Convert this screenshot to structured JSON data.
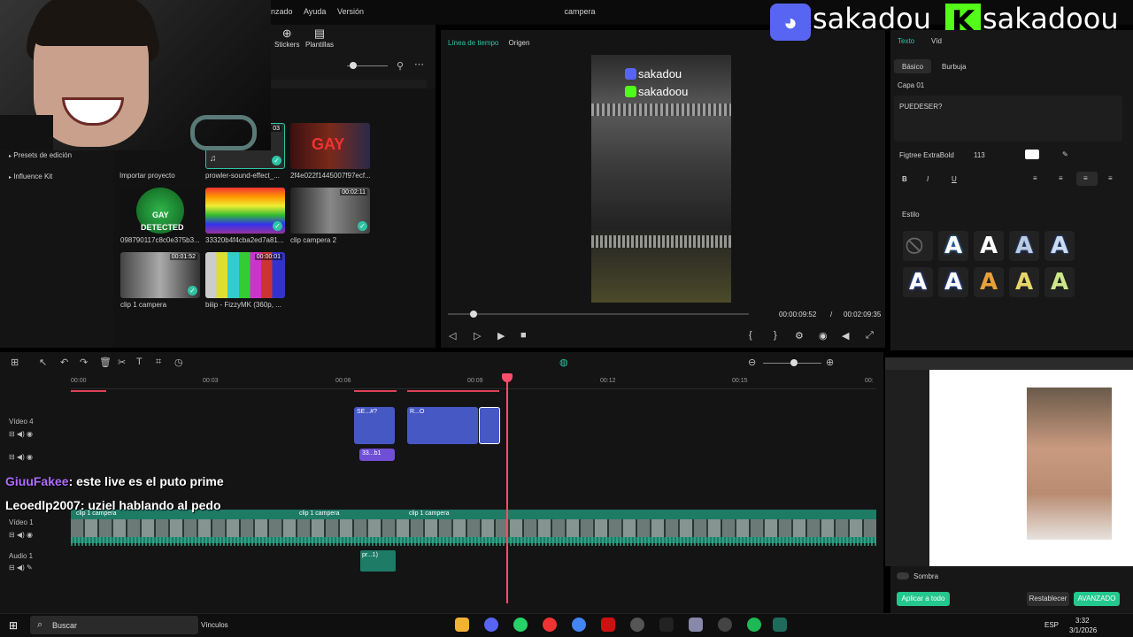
{
  "menubar": {
    "items": [
      "nzado",
      "Ayuda",
      "Versión"
    ],
    "title": "campera"
  },
  "left_panel": {
    "tools": [
      "Stickers",
      "Plantillas"
    ],
    "side_items": [
      "Presets de edición",
      "Influence Kit"
    ],
    "import_label": "Importar proyecto",
    "thumbs": [
      {
        "label": "prowler-sound-effect_...",
        "time": "03"
      },
      {
        "label": "2f4e022f1445007f97ecf...",
        "art": "GAY"
      },
      {
        "label": "098790117c8c0e375b3...",
        "art_line1": "GAY",
        "art_line2": "DETECTED"
      },
      {
        "label": "33320b4f4cba2ed7a81..."
      },
      {
        "label": "clip campera 2",
        "time": "00:02:11"
      },
      {
        "label": "clip 1 campera",
        "time": "00:01:52"
      },
      {
        "label": "biiip - FizzyMK (360p, ...",
        "time": "00:00:01"
      }
    ]
  },
  "preview": {
    "tabs": [
      "Línea de tiempo",
      "Origen"
    ],
    "overlay_discord": "sakadou",
    "overlay_kick": "sakadoou",
    "current_time": "00:00:09:52",
    "separator": "/",
    "total_time": "00:02:09:35"
  },
  "branding": {
    "discord_name": "sakadou",
    "kick_name": "sakadoou",
    "discord_color": "#5865f2",
    "kick_color": "#53fc18"
  },
  "right_panel": {
    "tabs": [
      "Texto",
      "Víd"
    ],
    "subtabs": [
      "Básico",
      "Burbuja"
    ],
    "layer": "Capa 01",
    "text_value": "PUEDESER?",
    "font": "Figtree ExtraBold",
    "size": "113",
    "style_label": "Estilo",
    "shadow_label": "Sombra",
    "apply_all": "Aplicar a todo",
    "reset": "Restablecer",
    "advanced": "AVANZADO"
  },
  "timeline": {
    "ruler": [
      "00:00",
      "00:03",
      "00:06",
      "00:09",
      "00:12",
      "00:15",
      "00:"
    ],
    "tracks": [
      "Vídeo 4",
      "Vídeo 1",
      "Audio 1"
    ],
    "clips": {
      "text1": "SE...#?",
      "text2": "R...O",
      "sub": "33...b1",
      "video_clip1": "clip 1 campera",
      "video_clip2": "clip 1 campera",
      "video_clip3": "clip 1 campera",
      "audio_clip": "pr...1)"
    }
  },
  "chat": [
    {
      "user": "GiuuFakee",
      "msg": ": este live es el puto prime"
    },
    {
      "user": "Leoedlp2007",
      "msg": ": uziel hablando al pedo"
    }
  ],
  "taskbar": {
    "search": "Buscar",
    "vinculos": "Vínculos",
    "lang": "ESP",
    "time": "3:32",
    "date": "3/1/2026"
  }
}
